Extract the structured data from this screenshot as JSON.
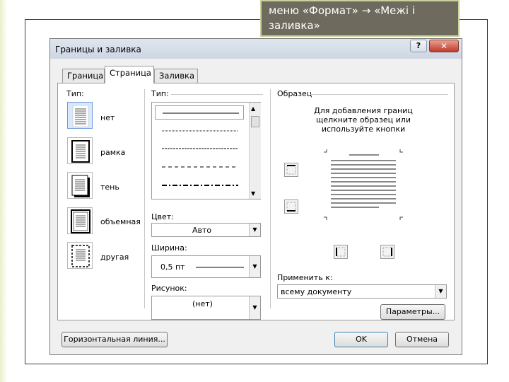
{
  "caption": {
    "line1": "меню «Формат» → «Межі і",
    "line2": "заливка»"
  },
  "dialog": {
    "title": "Границы и заливка",
    "help_label": "?",
    "close_label": "✕",
    "tabs": [
      {
        "label": "Граница",
        "active": false
      },
      {
        "label": "Страница",
        "active": true
      },
      {
        "label": "Заливка",
        "active": false
      }
    ]
  },
  "type_section": {
    "label": "Тип:",
    "options": [
      {
        "label": "нет",
        "icon": "border-none-icon",
        "selected": true
      },
      {
        "label": "рамка",
        "icon": "border-box-icon",
        "selected": false
      },
      {
        "label": "тень",
        "icon": "border-shadow-icon",
        "selected": false
      },
      {
        "label": "объемная",
        "icon": "border-3d-icon",
        "selected": false
      },
      {
        "label": "другая",
        "icon": "border-custom-icon",
        "selected": false
      }
    ]
  },
  "style_section": {
    "label": "Тип:",
    "styles": [
      "solid",
      "dotted",
      "dashed-fine",
      "dashed",
      "dash-dot"
    ]
  },
  "color_field": {
    "label": "Цвет:",
    "value": "Авто"
  },
  "width_field": {
    "label": "Ширина:",
    "value": "0,5 пт"
  },
  "art_field": {
    "label": "Рисунок:",
    "value": "(нет)"
  },
  "preview": {
    "label": "Образец",
    "description": "Для добавления границ щелкните образец или используйте кнопки"
  },
  "apply_to": {
    "label": "Применить к:",
    "value": "всему документу"
  },
  "buttons": {
    "options": "Параметры...",
    "horizontal_line": "Горизонтальная линия...",
    "ok": "OK",
    "cancel": "Отмена"
  },
  "colors": {
    "caption_bg": "#6f6a5e",
    "selection_blue": "#dbe8fb",
    "close_red": "#c0392b"
  }
}
